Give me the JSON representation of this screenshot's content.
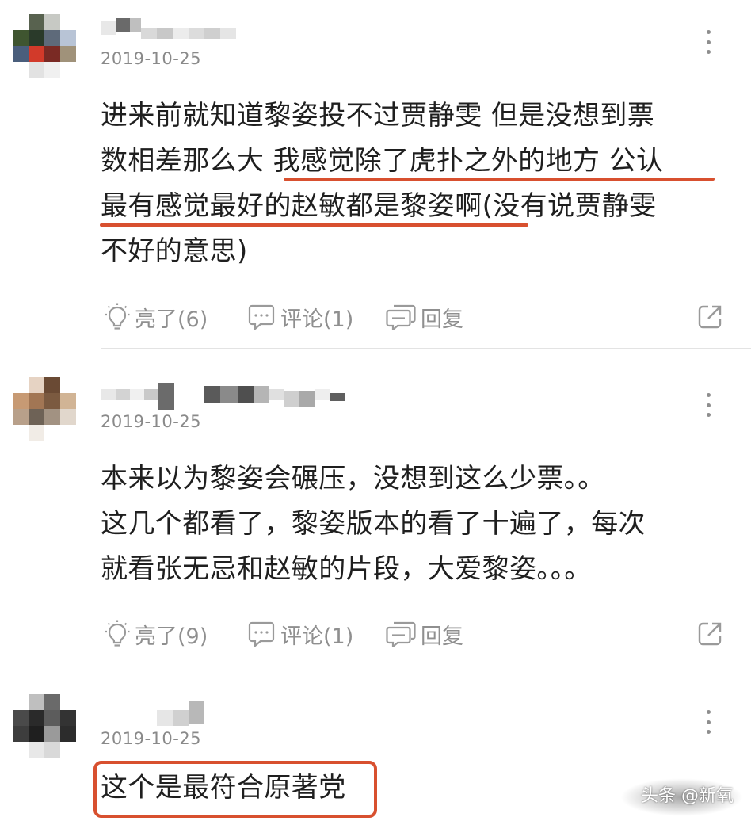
{
  "comments": [
    {
      "date": "2019-10-25",
      "lines": [
        "进来前就知道黎姿投不过贾静雯 但是没想到票",
        "数相差那么大 我感觉除了虎扑之外的地方 公认",
        "最有感觉最好的赵敏都是黎姿啊(没有说贾静雯",
        "不好的意思)"
      ],
      "like_label": "亮了(6)",
      "comment_label": "评论(1)",
      "reply_label": "回复"
    },
    {
      "date": "2019-10-25",
      "lines": [
        "本来以为黎姿会碾压，没想到这么少票。。",
        "这几个都看了，黎姿版本的看了十遍了，每次",
        "就看张无忌和赵敏的片段，大爱黎姿。。。"
      ],
      "like_label": "亮了(9)",
      "comment_label": "评论(1)",
      "reply_label": "回复"
    },
    {
      "date": "2019-10-25",
      "lines": [
        "这个是最符合原著党"
      ]
    }
  ],
  "watermark": {
    "text": "头条 @新氧"
  },
  "colors": {
    "highlight": "#d8502f",
    "meta_text": "#8a8a8a",
    "divider": "#e3e3e3"
  },
  "icons": [
    "lightbulb-icon",
    "comment-bubble-icon",
    "reply-bubbles-icon",
    "share-icon",
    "more-dots-icon"
  ]
}
